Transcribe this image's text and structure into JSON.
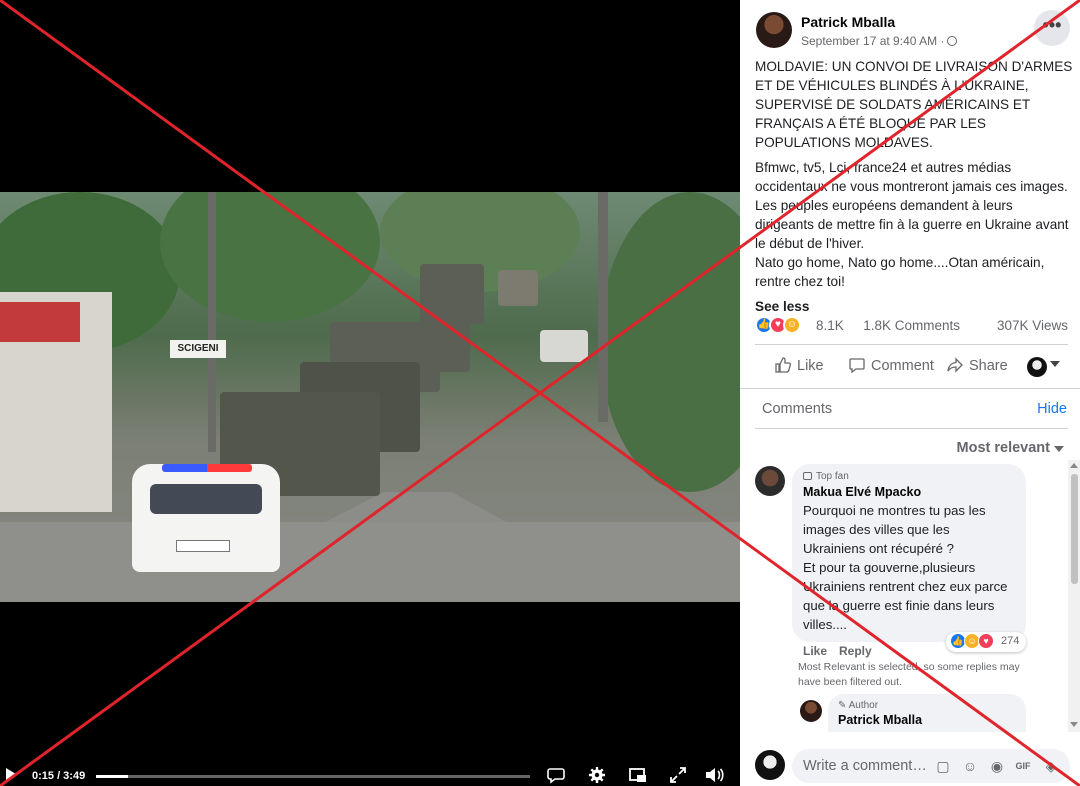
{
  "video": {
    "roadside_sign": "SCIGENI",
    "time": "0:15 / 3:49",
    "progress_fraction": 0.073,
    "controls": {
      "captions_icon": "captions-icon",
      "settings_icon": "gear-icon",
      "pip_icon": "picture-in-picture-icon",
      "fullscreen_icon": "fullscreen-icon",
      "volume_icon": "volume-icon"
    }
  },
  "post": {
    "author": "Patrick Mballa",
    "meta": "September 17 at 9:40 AM ·",
    "more_icon": "•••",
    "paragraphs": [
      "MOLDAVIE: UN CONVOI DE LIVRAISON D'ARMES ET DE VÉHICULES BLINDÉS À L'UKRAINE, SUPERVISÉ DE SOLDATS AMÉRICAINS ET FRANÇAIS A ÉTÉ BLOQUÉ PAR LES POPULATIONS MOLDAVES.",
      "Bfmwc, tv5, Lci, france24 et autres médias occidentaux ne vous montreront jamais ces images. Les peuples européens demandent à leurs dirigeants de mettre fin à la guerre en Ukraine avant le début de l'hiver.\nNato go home, Nato go home....Otan américain, rentre chez toi!"
    ],
    "see_less": "See less",
    "reactions": "8.1K",
    "comments_count": "1.8K Comments",
    "views": "307K Views",
    "actions": {
      "like": "Like",
      "comment": "Comment",
      "share": "Share"
    }
  },
  "comments": {
    "title": "Comments",
    "hide": "Hide",
    "sort": "Most relevant",
    "first": {
      "badge": "Top fan",
      "name": "Makua Elvé Mpacko",
      "text": "Pourquoi ne montres tu pas les images des villes que les Ukrainiens ont récupéré ?\nEt pour ta gouverne,plusieurs Ukrainiens rentrent chez eux parce que la guerre est finie dans leurs villes....",
      "reaction_count": "274",
      "like": "Like",
      "reply": "Reply"
    },
    "filter_note": "Most Relevant is selected, so some replies may have been filtered out.",
    "author_reply": {
      "badge": "Author",
      "name": "Patrick Mballa"
    },
    "write_placeholder": "Write a comment…"
  },
  "colors": {
    "link": "#1877f2",
    "secondary_text": "#65676b",
    "overlay_x": "#e0242b"
  }
}
